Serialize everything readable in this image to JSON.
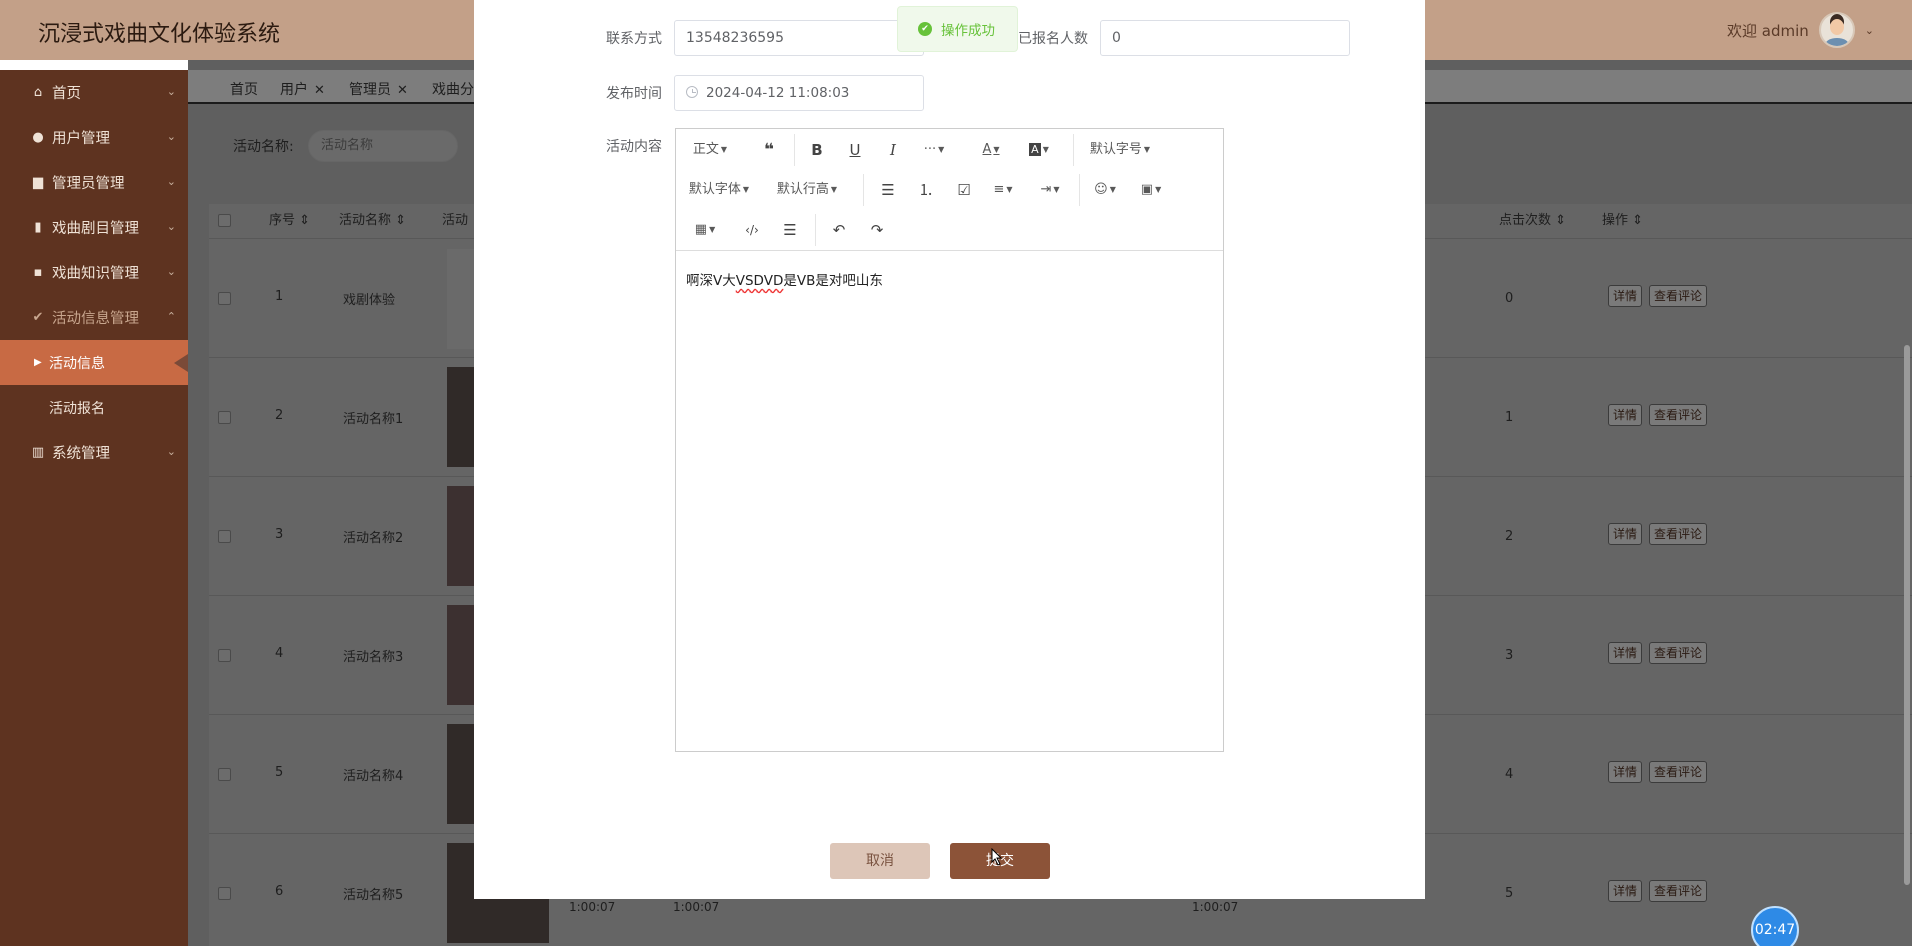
{
  "header": {
    "app_title": "沉浸式戏曲文化体验系统",
    "welcome": "欢迎 admin"
  },
  "sidebar": {
    "items": [
      {
        "label": "首页",
        "icon": "home-icon"
      },
      {
        "label": "用户管理",
        "icon": "user-icon"
      },
      {
        "label": "管理员管理",
        "icon": "admin-icon"
      },
      {
        "label": "戏曲剧目管理",
        "icon": "repertoire-icon"
      },
      {
        "label": "戏曲知识管理",
        "icon": "knowledge-icon"
      },
      {
        "label": "活动信息管理",
        "icon": "activity-icon"
      },
      {
        "label": "系统管理",
        "icon": "system-icon"
      }
    ],
    "sub_items": [
      {
        "label": "活动信息"
      },
      {
        "label": "活动报名"
      }
    ]
  },
  "tabs": [
    {
      "label": "首页"
    },
    {
      "label": "用户"
    },
    {
      "label": "管理员"
    },
    {
      "label": "戏曲分"
    }
  ],
  "search": {
    "label": "活动名称:",
    "placeholder": "活动名称"
  },
  "table": {
    "headers": {
      "index": "序号",
      "name": "活动名称",
      "name_partial": "活动",
      "clicks": "点击次数",
      "actions": "操作"
    },
    "rows": [
      {
        "index": "1",
        "name": "戏剧体验",
        "clicks": "0"
      },
      {
        "index": "2",
        "name": "活动名称1",
        "clicks": "1"
      },
      {
        "index": "3",
        "name": "活动名称2",
        "clicks": "2"
      },
      {
        "index": "4",
        "name": "活动名称3",
        "clicks": "3"
      },
      {
        "index": "5",
        "name": "活动名称4",
        "clicks": "4"
      },
      {
        "index": "6",
        "name": "活动名称5",
        "clicks": "5"
      }
    ],
    "detail_label": "详情",
    "comments_label": "查看评论",
    "time_fragment": "1:00:07"
  },
  "modal": {
    "contact_label": "联系方式",
    "contact_value": "13548236595",
    "signup_label": "已报名人数",
    "signup_value": "0",
    "publish_label": "发布时间",
    "publish_value": "2024-04-12 11:08:03",
    "content_label": "活动内容",
    "toolbar": {
      "paragraph": "正文",
      "font_size": "默认字号",
      "font_family": "默认字体",
      "line_height": "默认行高",
      "font_color": "A",
      "bg_color": "A"
    },
    "editor_text_1": "啊深V大",
    "editor_text_2": "VSDVD",
    "editor_text_3": "是VB是对吧山东",
    "cancel_label": "取消",
    "submit_label": "提交"
  },
  "toast": {
    "message": "操作成功"
  },
  "timer": {
    "value": "02:47"
  }
}
